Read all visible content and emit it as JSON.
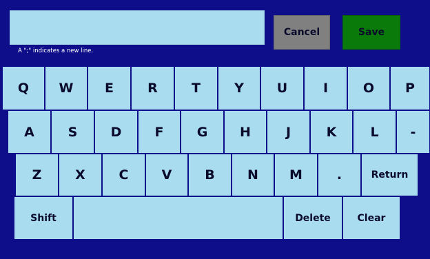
{
  "text_input": {
    "value": ""
  },
  "hint": "A \";\" indicates a new line.",
  "buttons": {
    "cancel": "Cancel",
    "save": "Save"
  },
  "keyboard": {
    "row1": [
      "Q",
      "W",
      "E",
      "R",
      "T",
      "Y",
      "U",
      "I",
      "O",
      "P"
    ],
    "row2": [
      "A",
      "S",
      "D",
      "F",
      "G",
      "H",
      "J",
      "K",
      "L",
      "-"
    ],
    "row3": [
      "Z",
      "X",
      "C",
      "V",
      "B",
      "N",
      "M",
      "."
    ],
    "return": "Return",
    "shift": "Shift",
    "space": "",
    "delete": "Delete",
    "clear": "Clear"
  },
  "colors": {
    "background": "#0e0e8a",
    "key": "#aadcf0",
    "cancel": "#808080",
    "save": "#0a7a0a"
  }
}
